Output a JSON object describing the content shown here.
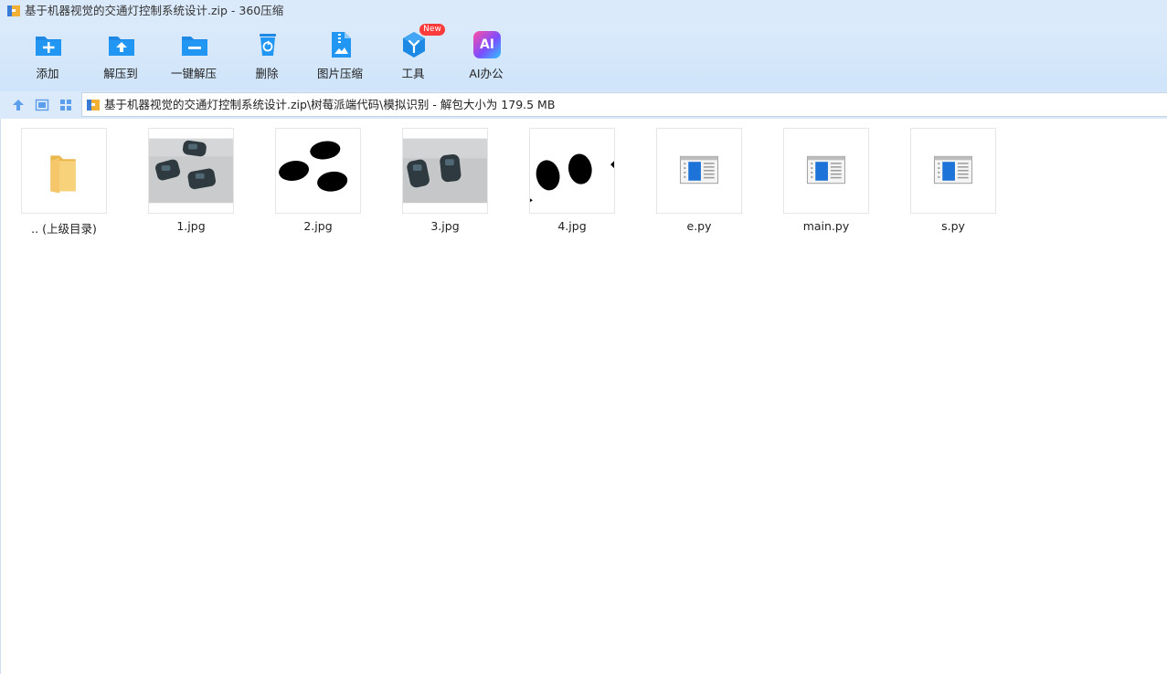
{
  "window": {
    "title": "基于机器视觉的交通灯控制系统设计.zip - 360压缩"
  },
  "toolbar": {
    "items": [
      {
        "label": "添加",
        "icon": "add-folder-icon"
      },
      {
        "label": "解压到",
        "icon": "extract-to-icon"
      },
      {
        "label": "一键解压",
        "icon": "one-click-extract-icon"
      },
      {
        "label": "删除",
        "icon": "recycle-bin-icon"
      },
      {
        "label": "图片压缩",
        "icon": "image-compress-icon"
      },
      {
        "label": "工具",
        "icon": "tools-icon",
        "badge": "New"
      },
      {
        "label": "AI办公",
        "icon": "ai-office-icon",
        "icon_text": "AI"
      }
    ]
  },
  "address": {
    "path": "基于机器视觉的交通灯控制系统设计.zip\\树莓派端代码\\模拟识别 - 解包大小为 179.5 MB"
  },
  "files": [
    {
      "name": ".. (上级目录)",
      "type": "parent-folder"
    },
    {
      "name": "1.jpg",
      "type": "image"
    },
    {
      "name": "2.jpg",
      "type": "image"
    },
    {
      "name": "3.jpg",
      "type": "image"
    },
    {
      "name": "4.jpg",
      "type": "image"
    },
    {
      "name": "e.py",
      "type": "python"
    },
    {
      "name": "main.py",
      "type": "python"
    },
    {
      "name": "s.py",
      "type": "python"
    }
  ],
  "colors": {
    "accent": "#1e88e5",
    "toolbar_bg": "#dbeafb",
    "folder": "#f5c76a",
    "badge": "#ff3b3b"
  }
}
